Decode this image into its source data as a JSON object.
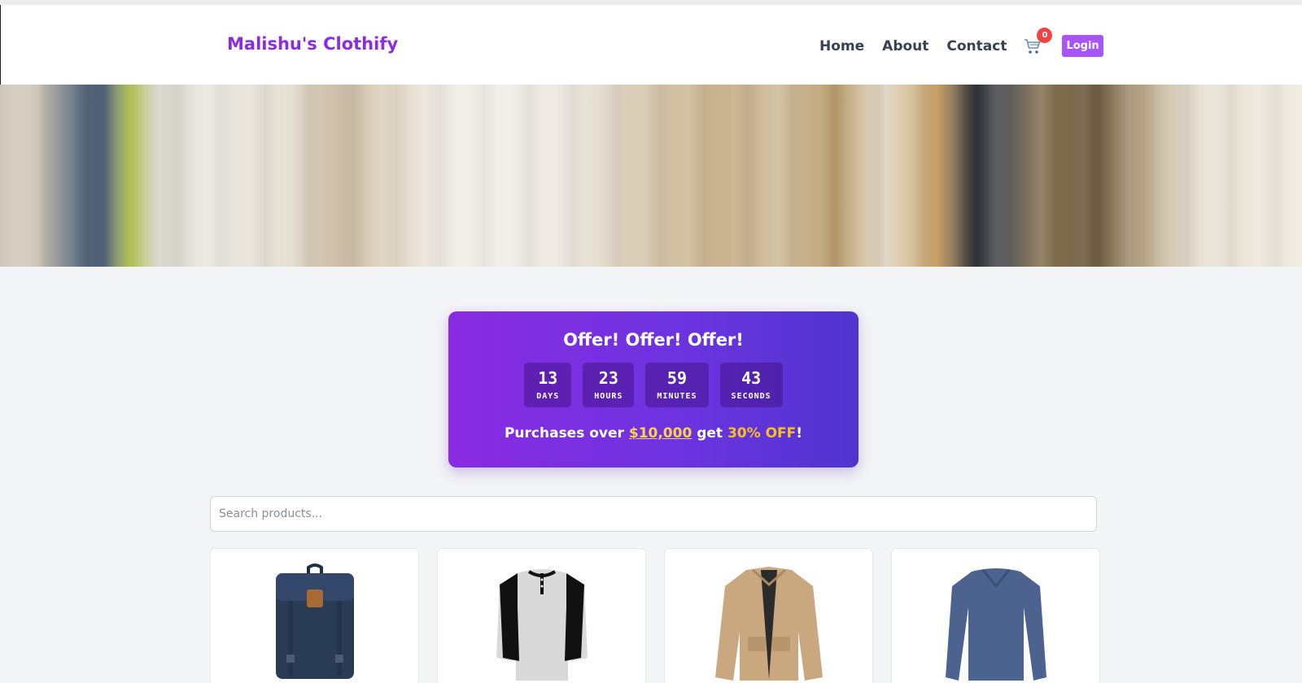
{
  "header": {
    "brand": "Malishu's Clothify",
    "nav": [
      "Home",
      "About",
      "Contact"
    ],
    "cart_icon": "cart-icon",
    "cart_count": "0",
    "login_label": "Login"
  },
  "hero": {
    "image": "clothing-rack-banner"
  },
  "offer": {
    "title": "Offer! Offer! Offer!",
    "countdown": [
      {
        "value": "13",
        "label": "DAYS"
      },
      {
        "value": "23",
        "label": "HOURS"
      },
      {
        "value": "59",
        "label": "MINUTES"
      },
      {
        "value": "43",
        "label": "SECONDS"
      }
    ],
    "line_prefix": "Purchases over ",
    "line_amount": "$10,000",
    "line_mid": " get ",
    "line_discount": "30% OFF",
    "line_suffix": "!",
    "colors": {
      "gradient_start": "#8a2be2",
      "gradient_end": "#4f35d0",
      "highlight": "#fbbf24"
    }
  },
  "search": {
    "placeholder": "Search products..."
  },
  "products": [
    {
      "image": "navy-backpack"
    },
    {
      "image": "raglan-henley-shirt"
    },
    {
      "image": "khaki-jacket"
    },
    {
      "image": "blue-long-sleeve-shirt"
    }
  ],
  "colors": {
    "brand": "#8b2be2",
    "login_button": "#a855f7",
    "badge": "#ef4444",
    "page_bg": "#f3f4f6"
  }
}
